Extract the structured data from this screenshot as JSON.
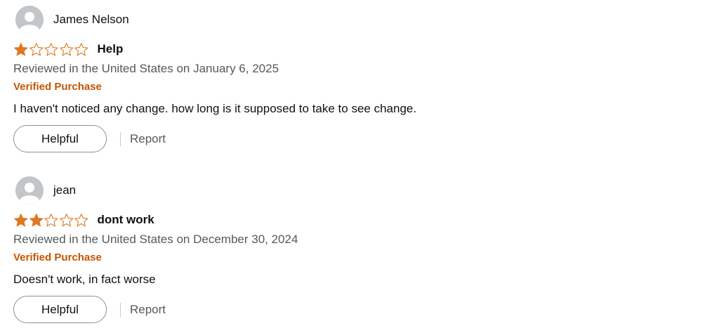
{
  "colors": {
    "star_fill": "#de7921",
    "star_outline": "#de7921",
    "verified": "#c45500",
    "muted_text": "#565959",
    "avatar_bg": "#c3c6c9"
  },
  "reviews": [
    {
      "profile_name": "James Nelson",
      "rating": 1,
      "rating_max": 5,
      "title": "Help",
      "date": "Reviewed in the United States on January 6, 2025",
      "verified": "Verified Purchase",
      "body": "I haven't noticed any change. how long is it supposed to take to see change.",
      "helpful_label": "Helpful",
      "report_label": "Report",
      "avatar_icon": "user-avatar-icon"
    },
    {
      "profile_name": "jean",
      "rating": 2,
      "rating_max": 5,
      "title": "dont work",
      "date": "Reviewed in the United States on December 30, 2024",
      "verified": "Verified Purchase",
      "body": "Doesn't work, in fact worse",
      "helpful_label": "Helpful",
      "report_label": "Report",
      "avatar_icon": "user-avatar-icon"
    }
  ]
}
